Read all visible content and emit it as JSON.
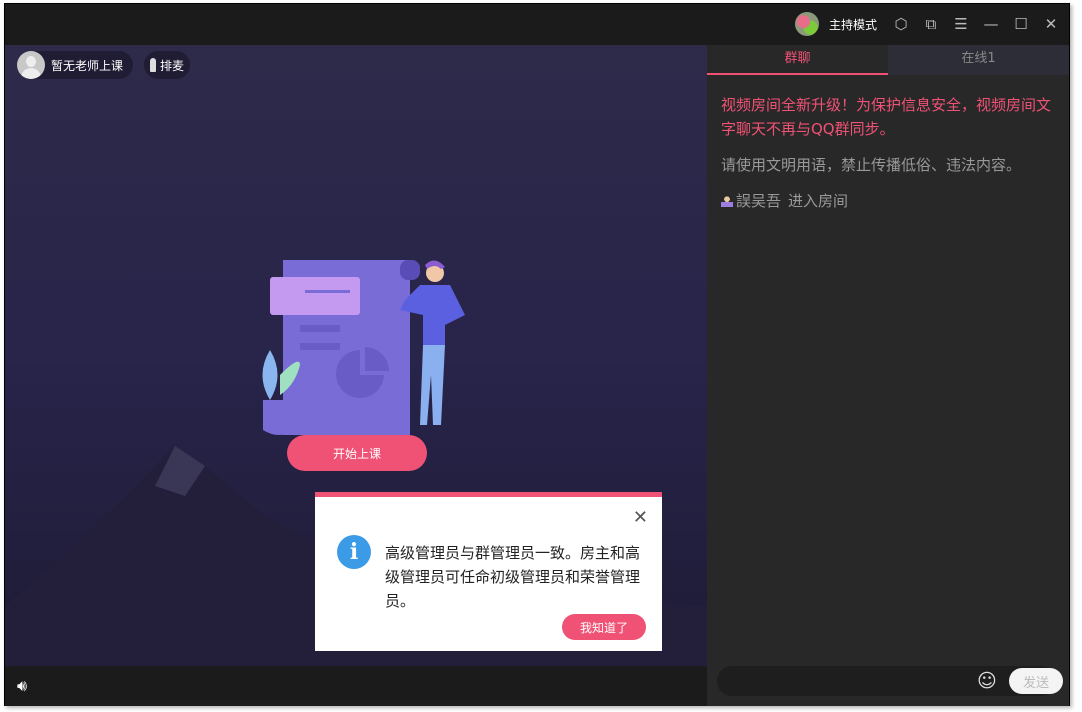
{
  "titlebar": {
    "mode_label": "主持模式"
  },
  "video": {
    "teacher_label": "暂无老师上课",
    "queue_label": "排麦",
    "start_button": "开始上课"
  },
  "dialog": {
    "message": "高级管理员与群管理员一致。房主和高级管理员可任命初级管理员和荣誉管理员。",
    "confirm": "我知道了"
  },
  "chat": {
    "tabs": [
      {
        "label": "群聊"
      },
      {
        "label": "在线1"
      }
    ],
    "messages": [
      {
        "text": "视频房间全新升级！为保护信息安全，视频房间文字聊天不再与QQ群同步。"
      },
      {
        "text": "请使用文明用语，禁止传播低俗、违法内容。"
      },
      {
        "user": "誤吴吾",
        "text": "进入房间"
      }
    ],
    "input_value": "",
    "send_label": "发送"
  },
  "colors": {
    "accent": "#f05275",
    "info": "#3c9be6"
  }
}
